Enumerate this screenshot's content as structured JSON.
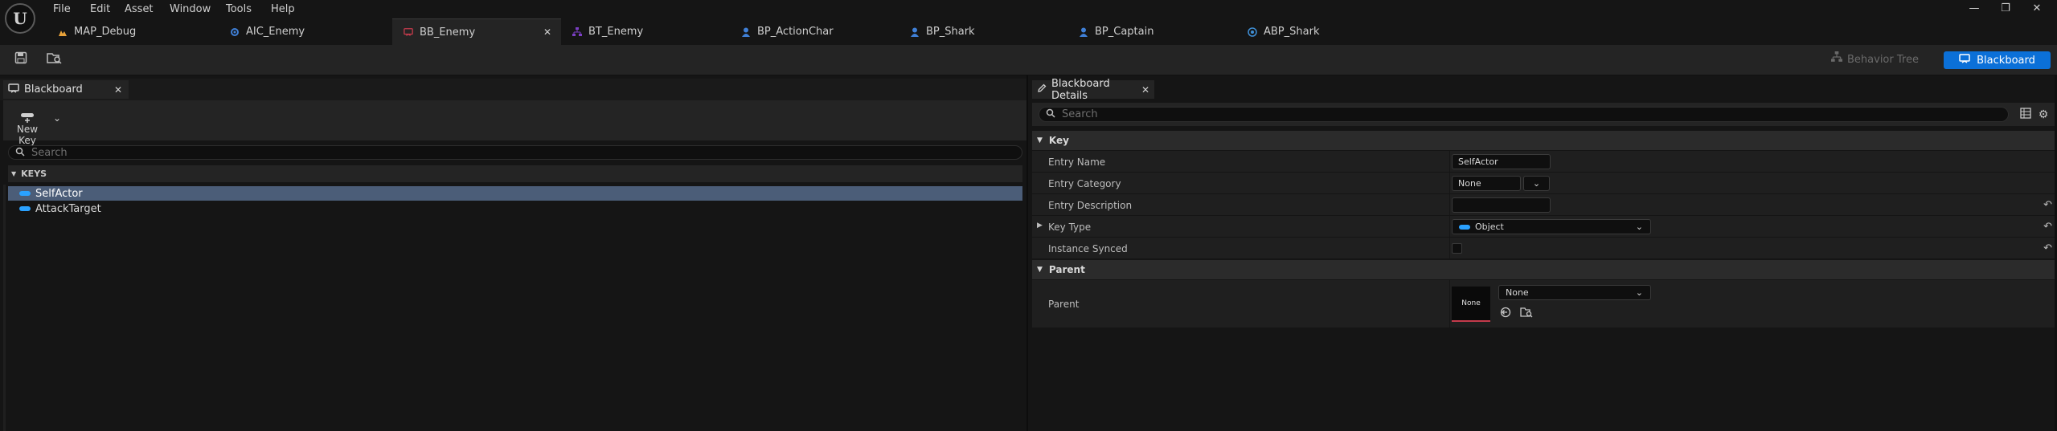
{
  "menu": {
    "items": [
      "File",
      "Edit",
      "Asset",
      "Window",
      "Tools",
      "Help"
    ]
  },
  "logo_text": "U",
  "window_controls": {
    "minimize": "—",
    "maximize": "❐",
    "close": "✕"
  },
  "doc_tabs": [
    {
      "label": "MAP_Debug",
      "icon": "map-icon",
      "color": "#e8a23a",
      "active": false
    },
    {
      "label": "AIC_Enemy",
      "icon": "ai-controller-icon",
      "color": "#3f7fd6",
      "active": false
    },
    {
      "label": "BB_Enemy",
      "icon": "blackboard-icon",
      "color": "#c53b4c",
      "active": true
    },
    {
      "label": "BT_Enemy",
      "icon": "behavior-tree-icon",
      "color": "#7b3fc4",
      "active": false
    },
    {
      "label": "BP_ActionChar",
      "icon": "blueprint-person-icon",
      "color": "#3f7fd6",
      "active": false
    },
    {
      "label": "BP_Shark",
      "icon": "blueprint-person-icon",
      "color": "#3f7fd6",
      "active": false
    },
    {
      "label": "BP_Captain",
      "icon": "blueprint-person-icon",
      "color": "#3f7fd6",
      "active": false
    },
    {
      "label": "ABP_Shark",
      "icon": "anim-blueprint-icon",
      "color": "#3f8fd6",
      "active": false
    }
  ],
  "toolbar": {
    "save_icon": "save-icon",
    "browse_icon": "browse-icon",
    "mode_behavior_tree": "Behavior Tree",
    "mode_blackboard": "Blackboard",
    "accent": "#0b70d8"
  },
  "blackboard_panel": {
    "tab_label": "Blackboard",
    "new_key_label": "New Key",
    "search_placeholder": "Search",
    "keys_header": "KEYS",
    "keys": [
      {
        "name": "SelfActor",
        "selected": true
      },
      {
        "name": "AttackTarget",
        "selected": false
      }
    ],
    "key_color": "#2aa1ff",
    "selected_color": "#4b5d78"
  },
  "details_panel": {
    "tab_label": "Blackboard Details",
    "search_placeholder": "Search",
    "key_section": "Key",
    "entry_name_label": "Entry Name",
    "entry_name_value": "SelfActor",
    "entry_category_label": "Entry Category",
    "entry_category_value": "None",
    "entry_description_label": "Entry Description",
    "entry_description_value": "",
    "key_type_label": "Key Type",
    "key_type_value": "Object",
    "instance_synced_label": "Instance Synced",
    "instance_synced_checked": false,
    "parent_section": "Parent",
    "parent_label": "Parent",
    "parent_thumbnail_text": "None",
    "parent_value": "None"
  }
}
